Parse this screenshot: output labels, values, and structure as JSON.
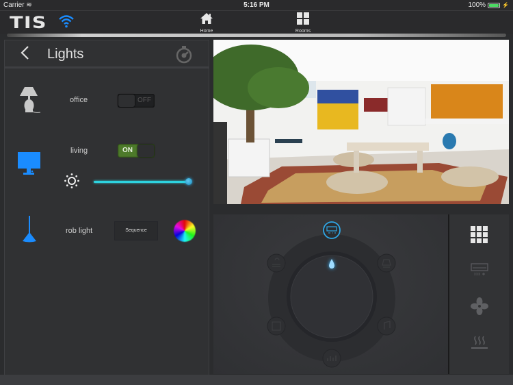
{
  "status_bar": {
    "carrier": "Carrier",
    "time": "5:16 PM",
    "battery": "100%"
  },
  "top_bar": {
    "logo": "TIS",
    "nav": [
      {
        "label": "Home",
        "icon": "home-icon"
      },
      {
        "label": "Rooms",
        "icon": "rooms-grid-icon"
      }
    ]
  },
  "left_panel": {
    "title": "Lights",
    "devices": [
      {
        "name": "office",
        "icon": "table-lamp-icon",
        "state": "OFF"
      },
      {
        "name": "living",
        "icon": "monitor-light-icon",
        "state": "ON",
        "brightness_percent": 100
      },
      {
        "name": "rob light",
        "icon": "pendant-lamp-icon",
        "action_label": "Sequence"
      }
    ]
  },
  "control_dial": {
    "active_mode": "air-conditioner",
    "modes": [
      "air-conditioner",
      "lights",
      "curtains",
      "music",
      "floor-heating",
      "media"
    ]
  },
  "side_panel": {
    "items": [
      "grid-icon",
      "ac-icon",
      "fan-icon",
      "heater-icon"
    ]
  },
  "colors": {
    "accent_blue": "#1a8cff",
    "slider": "#2ed3e0",
    "on_green": "#4d7a2a"
  }
}
